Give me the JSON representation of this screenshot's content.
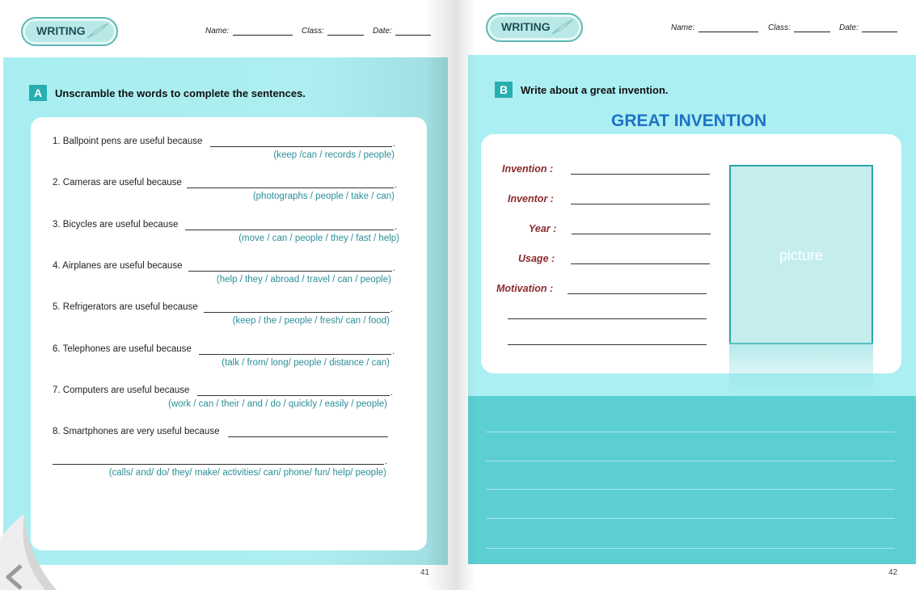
{
  "header": {
    "badge_label": "WRITING",
    "name_label": "Name:",
    "class_label": "Class:",
    "date_label": "Date:"
  },
  "left_page": {
    "section_letter": "A",
    "section_title": "Unscramble the words to complete the sentences.",
    "items": [
      {
        "text": "1. Ballpoint pens are useful because",
        "hint": "(keep /can / records / people)"
      },
      {
        "text": "2. Cameras are useful because",
        "hint": "(photographs / people / take / can)"
      },
      {
        "text": "3. Bicycles are useful because",
        "hint": "(move / can / people / they / fast / help)"
      },
      {
        "text": "4. Airplanes are useful because",
        "hint": "(help / they / abroad / travel / can / people)"
      },
      {
        "text": "5. Refrigerators are useful because",
        "hint": "(keep / the / people / fresh/ can / food)"
      },
      {
        "text": "6. Telephones are useful because",
        "hint": "(talk / from/ long/ people / distance / can)"
      },
      {
        "text": "7. Computers are useful because",
        "hint": "(work / can / their / and / do / quickly / easily / people)"
      },
      {
        "text": "8. Smartphones are very useful because",
        "hint": "(calls/ and/ do/ they/ make/ activities/ can/ phone/ fun/ help/ people)"
      }
    ],
    "page_number": "41"
  },
  "right_page": {
    "section_letter": "B",
    "section_title": "Write about a great invention.",
    "box_title": "GREAT INVENTION",
    "fields": {
      "invention": "Invention :",
      "inventor": "Inventor :",
      "year": "Year :",
      "usage": "Usage :",
      "motivation": "Motivation :"
    },
    "picture_label": "picture",
    "page_number": "42"
  },
  "colors": {
    "panel_light": "#aceff2",
    "panel_dark": "#5ccfd3",
    "section_badge": "#27aeb0",
    "hint_text": "#2a8f98",
    "field_label": "#8b2a2a",
    "title_blue": "#1e72c4"
  },
  "icons": [
    "feather-icon",
    "page-curl-back-icon"
  ]
}
